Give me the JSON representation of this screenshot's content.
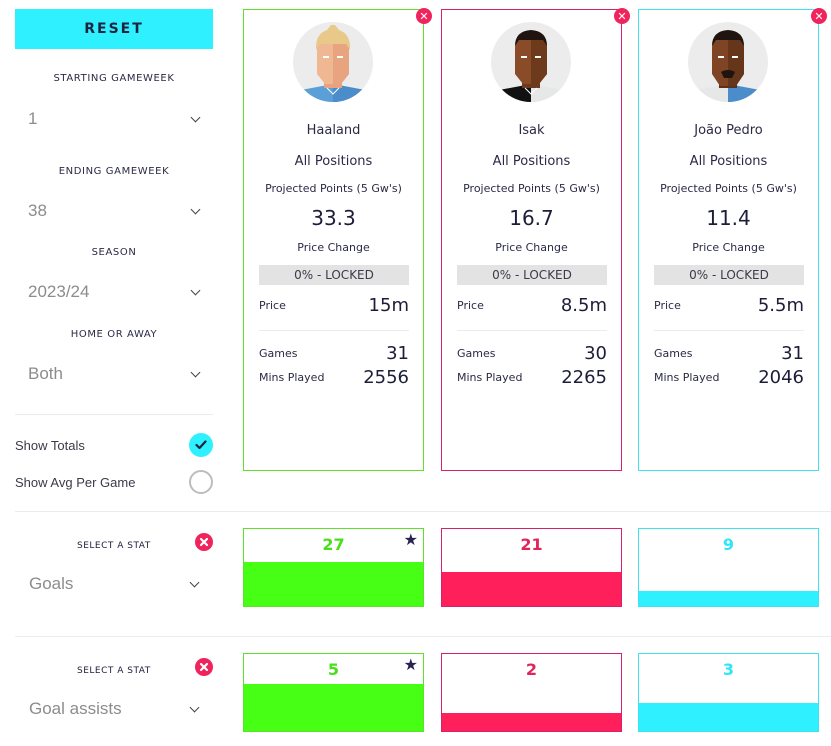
{
  "sidebar": {
    "reset_label": "RESET",
    "filters": [
      {
        "label": "STARTING GAMEWEEK",
        "value": "1"
      },
      {
        "label": "ENDING GAMEWEEK",
        "value": "38"
      },
      {
        "label": "SEASON",
        "value": "2023/24"
      },
      {
        "label": "HOME OR AWAY",
        "value": "Both"
      }
    ],
    "toggles": [
      {
        "label": "Show Totals",
        "checked": true
      },
      {
        "label": "Show Avg Per Game",
        "checked": false
      }
    ]
  },
  "players": [
    {
      "name": "Haaland",
      "position": "All Positions",
      "projected_label": "Projected Points (5 Gw's)",
      "projected": "33.3",
      "price_change_label": "Price Change",
      "price_change": "0% - LOCKED",
      "price_label": "Price",
      "price": "15m",
      "games_label": "Games",
      "games": "31",
      "mins_label": "Mins Played",
      "mins": "2556",
      "color": "#5fe02a",
      "remove_icon": "close-icon"
    },
    {
      "name": "Isak",
      "position": "All Positions",
      "projected_label": "Projected Points (5 Gw's)",
      "projected": "16.7",
      "price_change_label": "Price Change",
      "price_change": "0% - LOCKED",
      "price_label": "Price",
      "price": "8.5m",
      "games_label": "Games",
      "games": "30",
      "mins_label": "Mins Played",
      "mins": "2265",
      "color": "#d4236a",
      "remove_icon": "close-icon"
    },
    {
      "name": "João Pedro",
      "position": "All Positions",
      "projected_label": "Projected Points (5 Gw's)",
      "projected": "11.4",
      "price_change_label": "Price Change",
      "price_change": "0% - LOCKED",
      "price_label": "Price",
      "price": "5.5m",
      "games_label": "Games",
      "games": "31",
      "mins_label": "Mins Played",
      "mins": "2046",
      "color": "#3fe3ee",
      "remove_icon": "close-icon"
    }
  ],
  "stats": [
    {
      "label": "SELECT A STAT",
      "value": "Goals",
      "values": [
        "27",
        "21",
        "9"
      ],
      "fill_fraction": [
        0.57,
        0.44,
        0.19
      ],
      "best_index": 0
    },
    {
      "label": "SELECT A STAT",
      "value": "Goal assists",
      "values": [
        "5",
        "2",
        "3"
      ],
      "fill_fraction": [
        0.61,
        0.24,
        0.37
      ],
      "best_index": 0
    }
  ],
  "colors": {
    "accent": "#2ef0ff",
    "bar_green": "#47ff15",
    "bar_pink": "#ff1f5a",
    "bar_cyan": "#2ef0ff",
    "remove_red": "#f0245c",
    "star": "#2a2352"
  }
}
